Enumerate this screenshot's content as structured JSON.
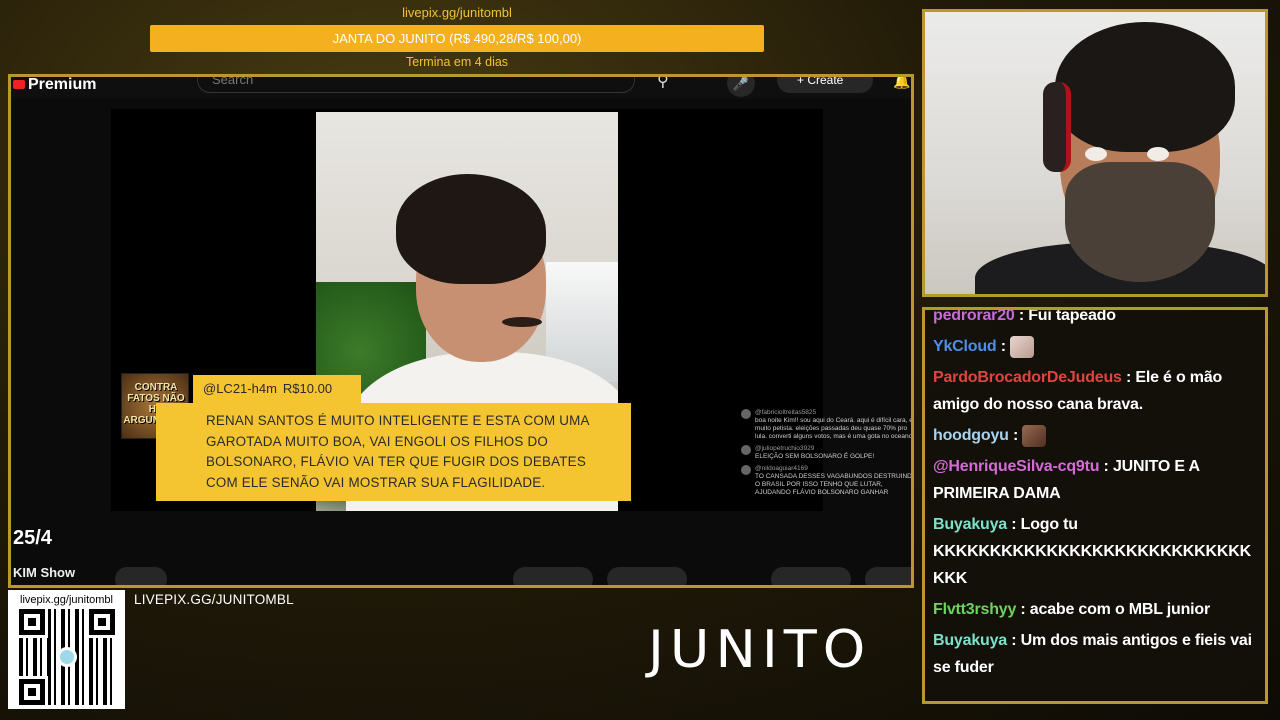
{
  "goal": {
    "url": "livepix.gg/junitombl",
    "title": "JANTA DO JUNITO (R$ 490,28/R$ 100,00)",
    "progress_percent": 100,
    "ends": "Termina em 4 dias"
  },
  "youtube": {
    "logo_text": "Premium",
    "search_placeholder": "Search",
    "create_label": "+ Create",
    "date_label": "25/4",
    "channel_name": "KIM Show"
  },
  "donation": {
    "thumb_text": "CONTRA FATOS NÃO HÁ ARGUMENTO",
    "user": "@LC21-h4m",
    "amount": "R$10.00",
    "message": "RENAN SANTOS É MUITO INTELIGENTE E ESTA COM UMA GAROTADA MUITO BOA, VAI ENGOLI OS FILHOS DO BOLSONARO, FLÁVIO VAI TER QUE FUGIR DOS DEBATES COM ELE SENÃO VAI MOSTRAR SUA FLAGILIDADE."
  },
  "video_comments": [
    {
      "user": "@fabricioltreitas5825",
      "text": "boa noite Kim!! sou aqui do Ceará. aqui é difícil cara, é muito petista. eleições passadas deu quase 70% pro lula. converti alguns votos, mas é uma gota no oceano"
    },
    {
      "user": "@juliopetruchio3929",
      "text": "ELEIÇÃO SEM BOLSONARO É GOLPE!"
    },
    {
      "user": "@nildoaguiar4169",
      "text": "TO CANSADA DESSES VAGABUNDOS DESTRUINDO O BRASIL POR ISSO TENHO QUE LUTAR, AJUDANDO FLÁVIO BOLSONARO GANHAR"
    }
  ],
  "chat": {
    "messages": [
      {
        "user": "pedrorar20",
        "color": "#c76bd6",
        "text": "Fui tapeado",
        "emote": null
      },
      {
        "user": "YkCloud",
        "color": "#4d8fe8",
        "text": "",
        "emote": "cat-emote"
      },
      {
        "user": "PardoBrocadorDeJudeus",
        "color": "#e0443e",
        "text": "Ele é o mão amigo do nosso cana brava.",
        "emote": null
      },
      {
        "user": "hoodgoyu",
        "color": "#a7d3f0",
        "text": "",
        "emote": "face-emote"
      },
      {
        "user": "@HenriqueSilva-cq9tu",
        "color": "#d46bd6",
        "text": "JUNITO E A PRIMEIRA DAMA",
        "emote": null
      },
      {
        "user": "Buyakuya",
        "color": "#7de0c8",
        "text": "Logo tu KKKKKKKKKKKKKKKKKKKKKKKKKKKKKKK",
        "emote": null
      },
      {
        "user": "Flvtt3rshyy",
        "color": "#6fd35f",
        "text": "acabe com o MBL junior",
        "emote": null
      },
      {
        "user": "Buyakuya",
        "color": "#7de0c8",
        "text": "Um dos mais antigos e fieis vai se fuder",
        "emote": null
      }
    ]
  },
  "bottom": {
    "qr_url": "livepix.gg/junitombl",
    "url_text": "LIVEPIX.GG/JUNITOMBL",
    "brand": "JUNITO"
  }
}
